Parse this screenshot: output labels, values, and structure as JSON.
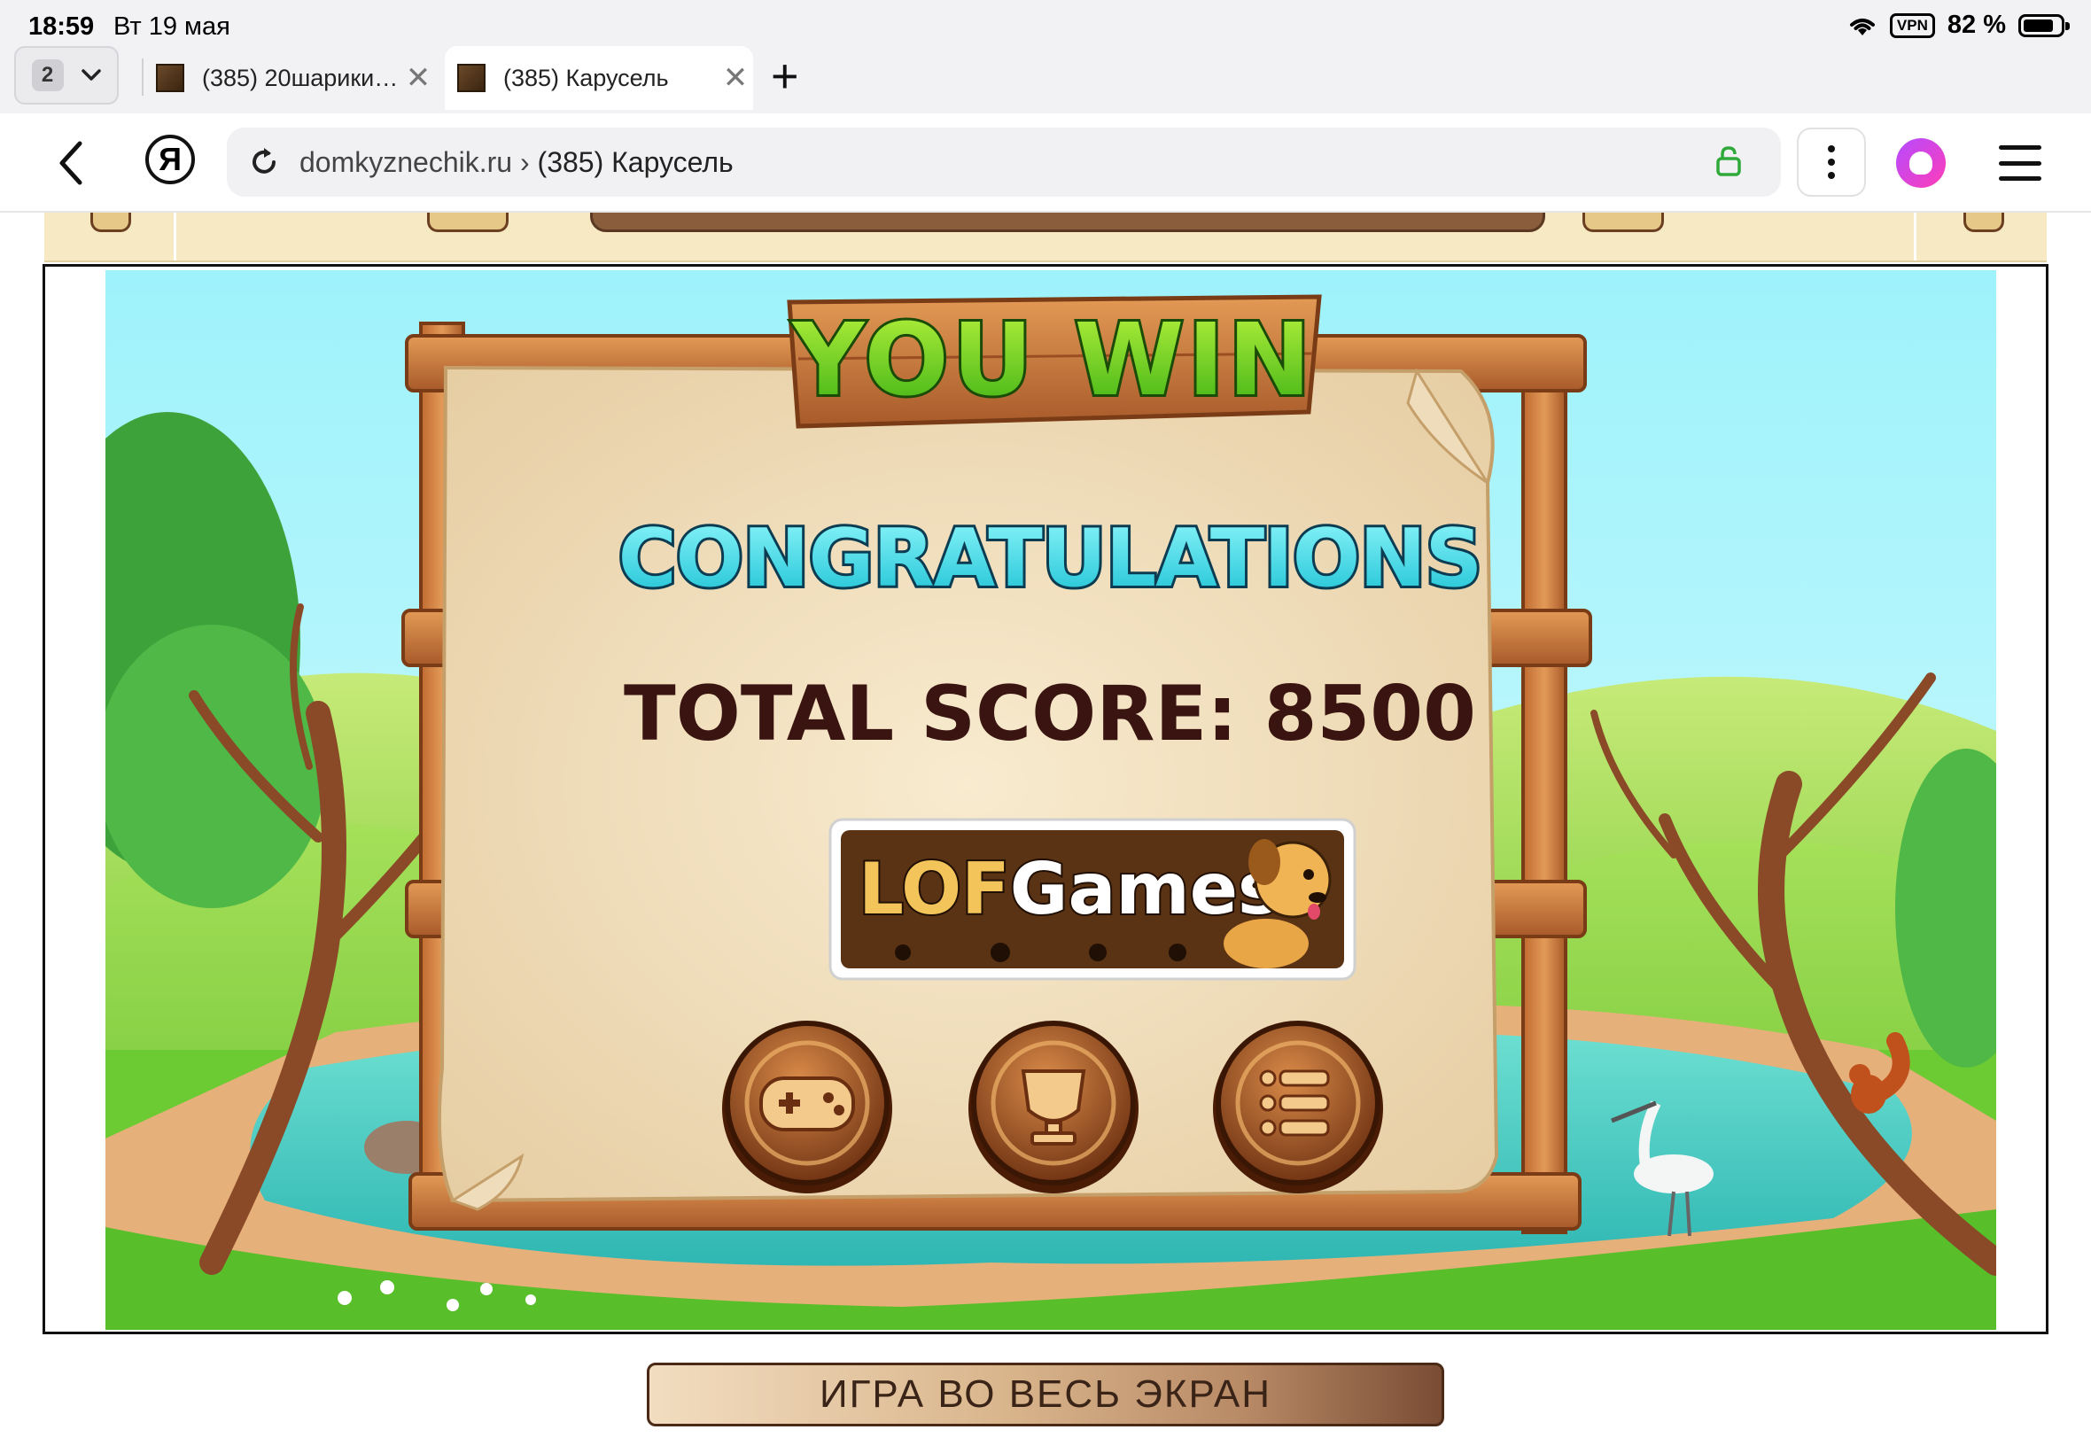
{
  "status_bar": {
    "time": "18:59",
    "date": "Вт 19 мая",
    "vpn": "VPN",
    "battery": "82 %",
    "battery_level": 0.82
  },
  "tabs": {
    "count": "2",
    "items": [
      {
        "title": "(385) 20шарики…",
        "active": false
      },
      {
        "title": "(385) Карусель",
        "active": true
      }
    ],
    "new_tab": "+"
  },
  "address_bar": {
    "domain": "domkyznechik.ru",
    "separator": " › ",
    "page_title": "(385) Карусель",
    "yandex_logo": "Я"
  },
  "game": {
    "title_you_win": "YOU WIN",
    "congrats": "CONGRATULATIONS",
    "score_label": "TOTAL SCORE:",
    "score_value": "8500",
    "brand": {
      "lof": "LOF",
      "games": "Games"
    },
    "buttons": [
      {
        "name": "play-again-button",
        "icon": "gamepad-icon"
      },
      {
        "name": "leaderboard-button",
        "icon": "trophy-icon"
      },
      {
        "name": "menu-button",
        "icon": "list-menu-icon"
      }
    ],
    "colors": {
      "sky": "#9eeefa",
      "grass": "#64c832",
      "water": "#3cc8c0",
      "wood": "#c8753a",
      "parchment": "#f0dfbf",
      "win_text": "#6ddc18",
      "congrats_text": "#3fe0e8",
      "score_text": "#3a1410"
    }
  },
  "fullscreen_button": {
    "label": "ИГРА ВО ВЕСЬ ЭКРАН"
  }
}
